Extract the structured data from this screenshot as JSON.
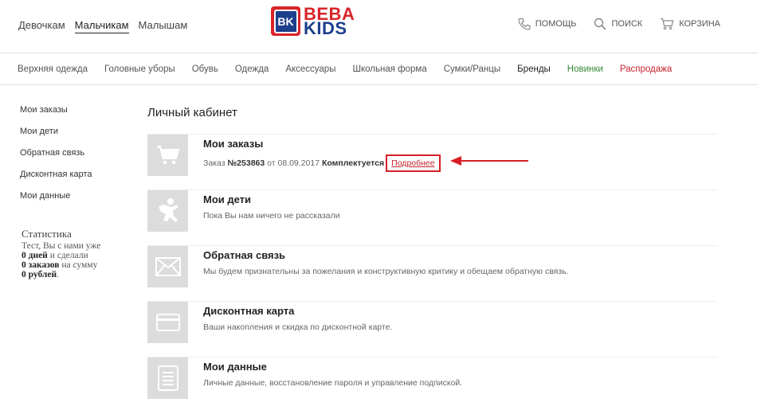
{
  "header": {
    "gender_nav": [
      "Девочкам",
      "Мальчикам",
      "Малышам"
    ],
    "gender_active": "Мальчикам",
    "logo": {
      "line1": "BEBA",
      "line2": "KIDS",
      "badge": "BK",
      "brand_red": "#d8242a",
      "brand_blue": "#1d3f8c"
    },
    "util": {
      "help": {
        "label": "ПОМОЩЬ",
        "icon": "phone-icon"
      },
      "search": {
        "label": "ПОИСК",
        "icon": "search-icon"
      },
      "cart": {
        "label": "КОРЗИНА",
        "icon": "cart-icon"
      }
    }
  },
  "categories": [
    "Верхняя одежда",
    "Головные уборы",
    "Обувь",
    "Одежда",
    "Аксессуары",
    "Школьная форма",
    "Сумки/Ранцы",
    "Бренды",
    "Новинки",
    "Распродажа"
  ],
  "sidebar": {
    "items": [
      "Мои заказы",
      "Мои дети",
      "Обратная связь",
      "Дисконтная карта",
      "Мои данные"
    ]
  },
  "stats": {
    "title": "Статистика",
    "line1": "Тест, Вы с нами уже",
    "days_value": "0",
    "days_label": "дней",
    "days_suffix": "и сделали",
    "orders_value": "0",
    "orders_label": "заказов",
    "orders_suffix": "на сумму",
    "rub_value": "0",
    "rub_label": "рублей",
    "rub_suffix": "."
  },
  "main": {
    "title": "Личный кабинет",
    "sections": [
      {
        "title": "Мои заказы",
        "icon": "cart-icon",
        "order": {
          "prefix": "Заказ",
          "number": "№253863",
          "date_text": "от 08.09.2017",
          "status": "Комплектуется",
          "details_link": "Подробнее"
        }
      },
      {
        "title": "Мои дети",
        "icon": "child-icon",
        "desc": "Пока Вы нам ничего не рассказали"
      },
      {
        "title": "Обратная связь",
        "icon": "envelope-icon",
        "desc": "Мы будем признательны за пожелания и конструктивную критику и обещаем обратную связь."
      },
      {
        "title": "Дисконтная карта",
        "icon": "card-icon",
        "desc": "Ваши накопления и скидка по дисконтной карте."
      },
      {
        "title": "Мои данные",
        "icon": "document-icon",
        "desc": "Личные данные, восстановление пароля и управление подпиской."
      }
    ]
  },
  "annotation": {
    "color": "#d81e26"
  }
}
